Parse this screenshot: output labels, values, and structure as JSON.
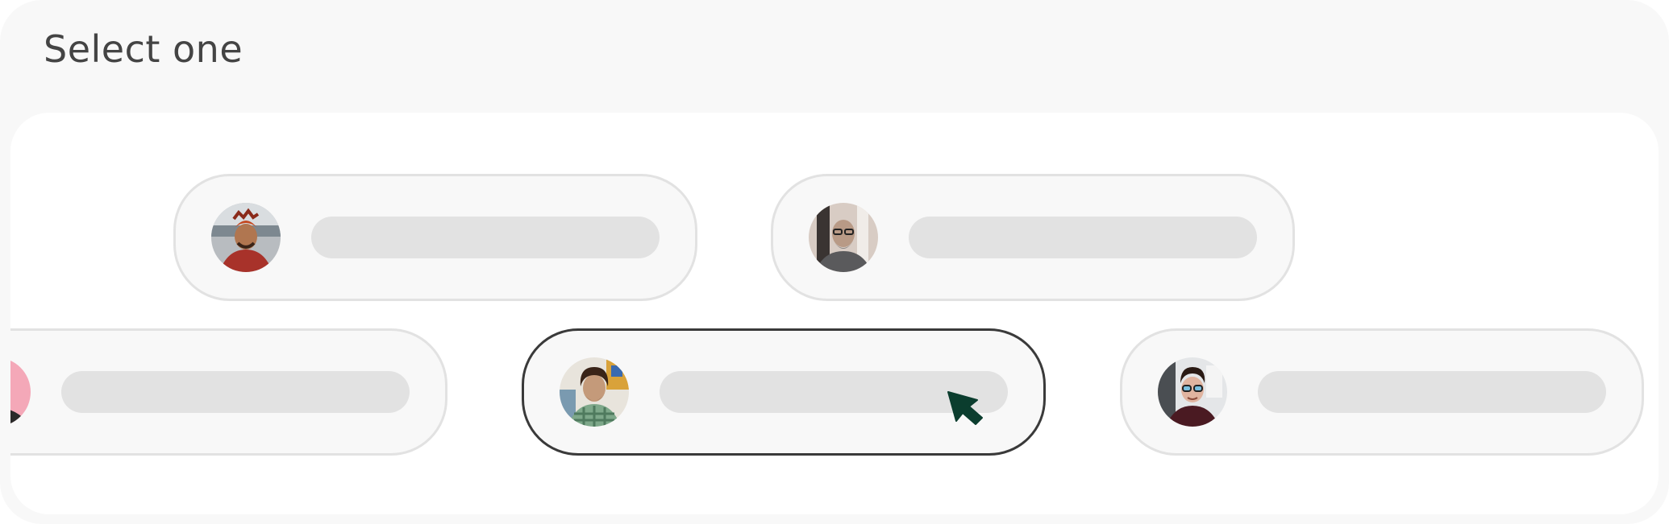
{
  "page": {
    "title": "Select one"
  },
  "options": [
    {
      "id": "opt-1",
      "avatar": "man-red-headscarf",
      "selected": false
    },
    {
      "id": "opt-2",
      "avatar": "man-glasses-grey-beard",
      "selected": false
    },
    {
      "id": "opt-3",
      "avatar": "partial-pink-avatar",
      "selected": false
    },
    {
      "id": "opt-4",
      "avatar": "man-curly-hair-plaid-shirt",
      "selected": true
    },
    {
      "id": "opt-5",
      "avatar": "man-glasses-dark-sweater",
      "selected": false
    }
  ],
  "cursor": {
    "icon": "pointer-arrow-icon",
    "color": "#0b3d2e"
  },
  "colors": {
    "panel_bg": "#f8f8f8",
    "card_bg": "#ffffff",
    "option_border": "#e2e2e2",
    "selected_border": "#3a3a3a",
    "placeholder_bar": "#e2e2e2"
  }
}
